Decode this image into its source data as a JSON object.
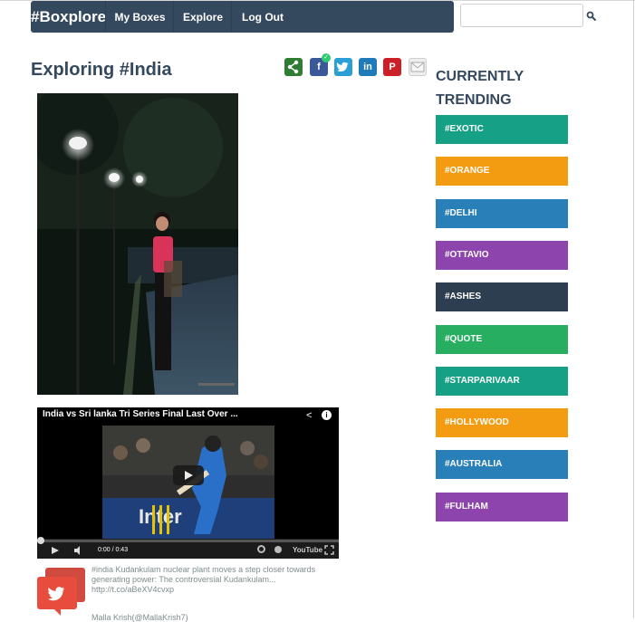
{
  "nav": {
    "brand": "#Boxplore",
    "items": [
      {
        "label": "My Boxes"
      },
      {
        "label": "Explore"
      },
      {
        "label": "Log Out"
      }
    ],
    "search": {
      "value": "",
      "placeholder": ""
    }
  },
  "page": {
    "title": "Exploring #India"
  },
  "share_icons": [
    "share-icon",
    "facebook-icon",
    "twitter-icon",
    "linkedin-icon",
    "pinterest-icon",
    "email-icon"
  ],
  "colors": {
    "navbar": "#34495e",
    "turquoise": "#16a085",
    "orange": "#f39c12",
    "blue": "#2980b9",
    "purple": "#8e44ad",
    "dark": "#2c3e50",
    "green": "#27ae60",
    "twitter_red": "#e74c3c"
  },
  "video": {
    "title": "India vs Sri lanka Tri Series Final Last Over ...",
    "time": "0:00 / 0:43",
    "brand": "YouTube"
  },
  "tweet": {
    "text": "#india Kudankulam nuclear plant moves a step closer towards generating power: The controversial Kudankulam... http://t.co/aBeXV4cvxp",
    "user": "Malla Krish(@MallaKrish7)"
  },
  "trending": {
    "title": "CURRENTLY TRENDING",
    "tags": [
      {
        "label": "#EXOTIC",
        "color": "#16a085"
      },
      {
        "label": "#ORANGE",
        "color": "#f39c12"
      },
      {
        "label": "#DELHI",
        "color": "#2980b9"
      },
      {
        "label": "#OTTAVIO",
        "color": "#8e44ad"
      },
      {
        "label": "#ASHES",
        "color": "#2c3e50"
      },
      {
        "label": "#QUOTE",
        "color": "#27ae60"
      },
      {
        "label": "#STARPARIVAAR",
        "color": "#16a085"
      },
      {
        "label": "#HOLLYWOOD",
        "color": "#f39c12"
      },
      {
        "label": "#AUSTRALIA",
        "color": "#2980b9"
      },
      {
        "label": "#FULHAM",
        "color": "#8e44ad"
      }
    ]
  }
}
